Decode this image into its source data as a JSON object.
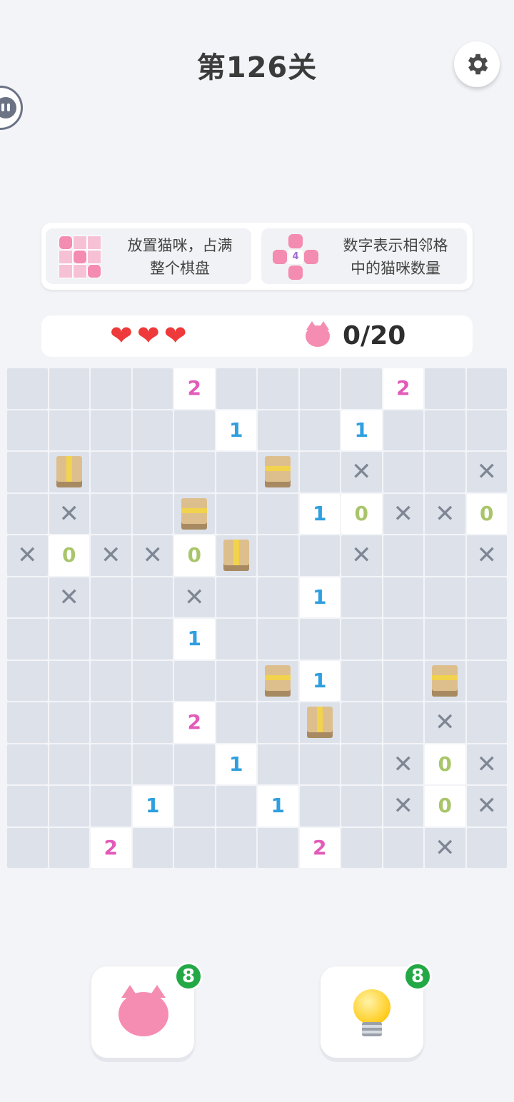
{
  "header": {
    "title": "第126关"
  },
  "rules": {
    "left_line1": "放置猫咪，占满",
    "left_line2": "整个棋盘",
    "right_line1": "数字表示相邻格",
    "right_line2": "中的猫咪数量",
    "right_example_number": "4"
  },
  "status": {
    "hearts": 3,
    "cats_counter": "0/20"
  },
  "colors": {
    "number_2": "#e35bb8",
    "number_1": "#2f9fe0",
    "number_0": "#a9c56a",
    "heart": "#ee3a3a",
    "badge": "#23a846"
  },
  "board": {
    "rows": [
      [
        "",
        "",
        "",
        "",
        "2",
        "",
        "",
        "",
        "",
        "2",
        "",
        ""
      ],
      [
        "",
        "",
        "",
        "",
        "",
        "1",
        "",
        "",
        "1",
        "",
        "",
        ""
      ],
      [
        "",
        "bv",
        "",
        "",
        "",
        "",
        "bh",
        "",
        "x",
        "",
        "",
        "x"
      ],
      [
        "",
        "x",
        "",
        "",
        "bh",
        "",
        "",
        "1",
        "0",
        "x",
        "x",
        "0"
      ],
      [
        "x",
        "0",
        "x",
        "x",
        "0",
        "bv",
        "",
        "",
        "x",
        "",
        "",
        "x"
      ],
      [
        "",
        "x",
        "",
        "",
        "x",
        "",
        "",
        "1",
        "",
        "",
        "",
        ""
      ],
      [
        "",
        "",
        "",
        "",
        "1",
        "",
        "",
        "",
        "",
        "",
        "",
        ""
      ],
      [
        "",
        "",
        "",
        "",
        "",
        "",
        "bh",
        "1",
        "",
        "",
        "bh",
        ""
      ],
      [
        "",
        "",
        "",
        "",
        "2",
        "",
        "",
        "bv",
        "",
        "",
        "x",
        ""
      ],
      [
        "",
        "",
        "",
        "",
        "",
        "1",
        "",
        "",
        "",
        "x",
        "0",
        "x"
      ],
      [
        "",
        "",
        "",
        "1",
        "",
        "",
        "1",
        "",
        "",
        "x",
        "0",
        "x"
      ],
      [
        "",
        "",
        "2",
        "",
        "",
        "",
        "",
        "2",
        "",
        "",
        "x",
        ""
      ]
    ]
  },
  "tools": {
    "cat_tool": {
      "icon": "winking-cat-icon",
      "count": "8"
    },
    "hint_tool": {
      "icon": "lightbulb-icon",
      "count": "8"
    }
  }
}
